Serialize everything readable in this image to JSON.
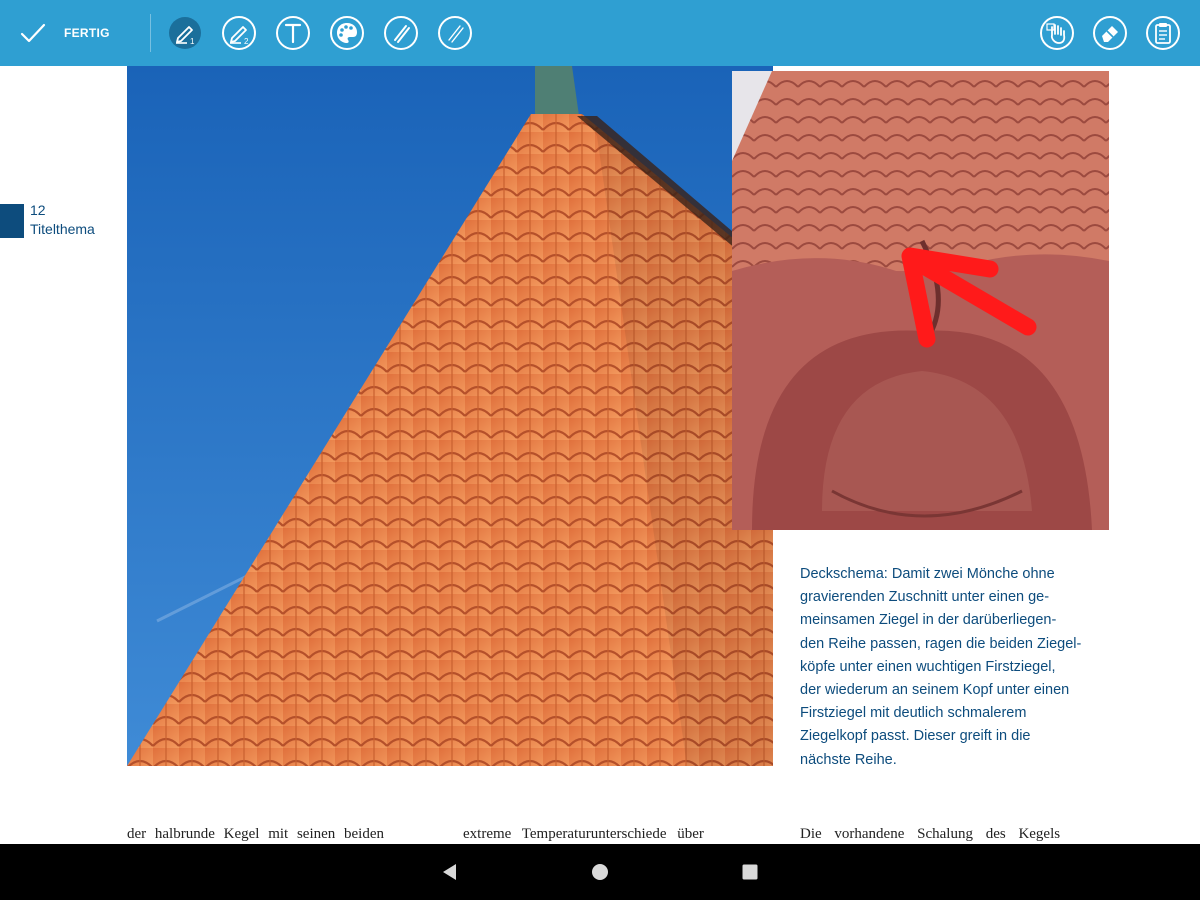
{
  "toolbar": {
    "done_label": "FERTIG",
    "tool_icons": [
      "pen-1-icon",
      "pen-2-icon",
      "text-icon",
      "color-palette-icon",
      "highlighter-1-icon",
      "highlighter-2-icon"
    ],
    "right_icons": [
      "hand-icon",
      "eraser-icon",
      "clipboard-icon"
    ],
    "color": "#2f9fd2",
    "active_color": "#1b6f9b"
  },
  "page": {
    "number": "12",
    "section": "Titelthema",
    "accent_color": "#0d4c7d",
    "annotation_color": "#ff1a1a",
    "caption_lines": [
      "Deckschema: Damit zwei Mönche ohne",
      "gravierenden Zuschnitt unter einen ge-",
      "meinsamen Ziegel in der darüberliegen-",
      "den Reihe passen, ragen die beiden Ziegel-",
      "köpfe unter einen wuchtigen Firstziegel,",
      "der wiederum an seinem Kopf unter einen",
      "Firstziegel mit deutlich schmalerem",
      "Ziegelkopf passt. Dieser  greift in die",
      "nächste Reihe."
    ],
    "body_columns": [
      "der halbrunde Kegel mit seinen beiden",
      "extreme Temperaturunterschiede über",
      "Die vorhandene Schalung des Kegels"
    ]
  },
  "navbar": {
    "icons": [
      "back-icon",
      "home-icon",
      "recents-icon"
    ]
  }
}
